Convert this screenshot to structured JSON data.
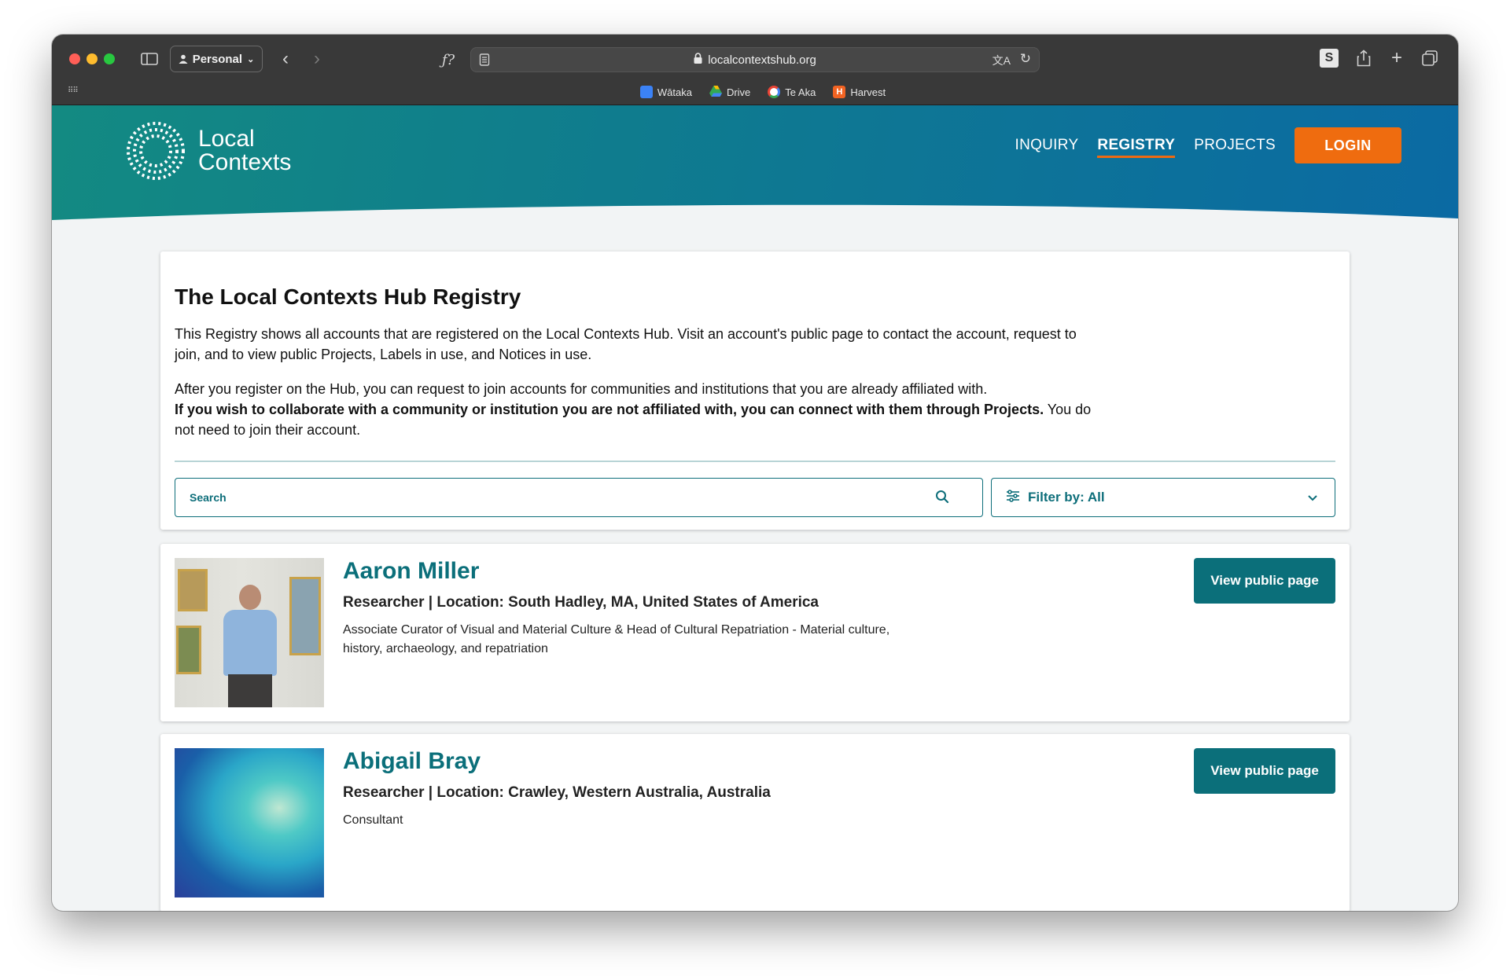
{
  "browser": {
    "profile_label": "Personal",
    "reader_label": "ƒ?",
    "url": "localcontextshub.org",
    "favorites": [
      {
        "label": "Wātaka",
        "color": "#3b82f6"
      },
      {
        "label": "Drive",
        "color": "#34a853"
      },
      {
        "label": "Te Aka",
        "color": "#ea4335"
      },
      {
        "label": "Harvest",
        "color": "#f26322"
      }
    ]
  },
  "site": {
    "logo_line1": "Local",
    "logo_line2": "Contexts",
    "nav": [
      "INQUIRY",
      "REGISTRY",
      "PROJECTS"
    ],
    "login_label": "LOGIN"
  },
  "intro": {
    "title": "The Local Contexts Hub Registry",
    "paragraph1": "This Registry shows all accounts that are registered on the Local Contexts Hub. Visit an account's public page to contact the account, request to join, and to view public Projects, Labels in use, and Notices in use.",
    "paragraph2_plain": "After you register on the Hub, you can request to join accounts for communities and institutions that you are already affiliated with.",
    "paragraph2_bold": "If you wish to collaborate with a community or institution you are not affiliated with, you can connect with them through Projects.",
    "paragraph2_tail": " You do not need to join their account.",
    "search_placeholder": "Search",
    "filter_label": "Filter by: All"
  },
  "entries": [
    {
      "name": "Aaron Miller",
      "meta": "Researcher | Location: South Hadley, MA, United States of America",
      "description": "Associate Curator of Visual and Material Culture & Head of Cultural Repatriation - Material culture, history, archaeology, and repatriation",
      "button": "View public page"
    },
    {
      "name": "Abigail Bray",
      "meta": "Researcher | Location: Crawley, Western Australia, Australia",
      "description": "Consultant",
      "button": "View public page"
    }
  ],
  "colors": {
    "teal": "#0b6f7a",
    "orange": "#ef6c0f",
    "header_start": "#138a82",
    "header_end": "#0b6aa3"
  }
}
